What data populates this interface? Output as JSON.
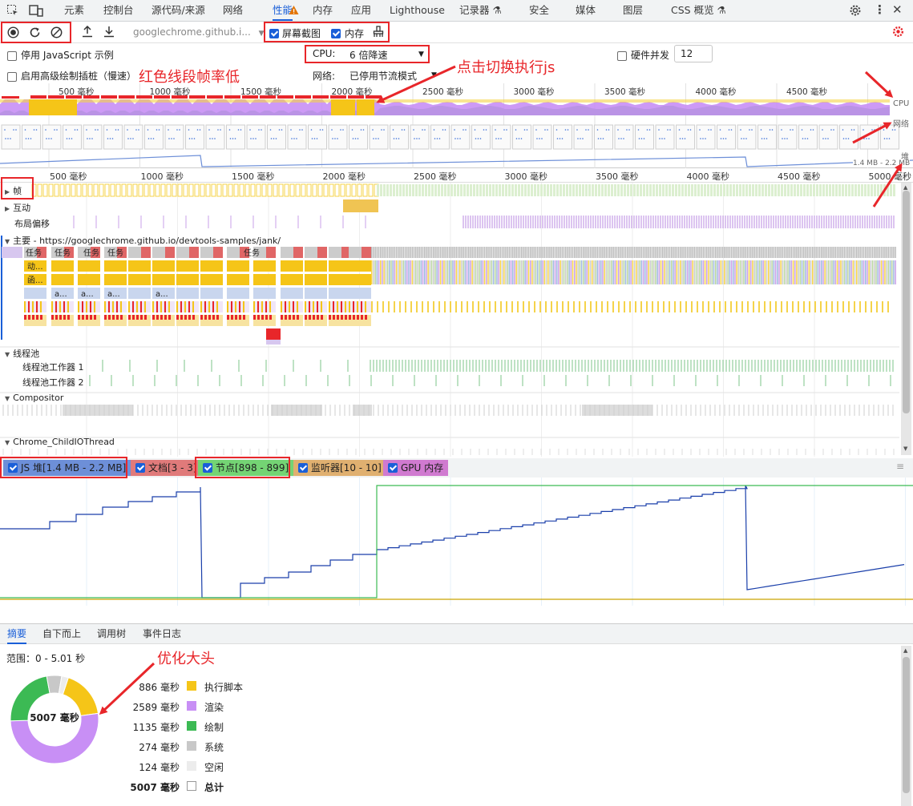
{
  "tabs": [
    {
      "label": "元素",
      "active": false
    },
    {
      "label": "控制台",
      "active": false
    },
    {
      "label": "源代码/来源",
      "active": false
    },
    {
      "label": "网络",
      "active": false
    },
    {
      "label": "性能",
      "active": true
    },
    {
      "label": "内存",
      "active": false
    },
    {
      "label": "应用",
      "active": false
    },
    {
      "label": "Lighthouse",
      "active": false
    },
    {
      "label": "记录器",
      "active": false
    },
    {
      "label": "安全",
      "active": false
    },
    {
      "label": "媒体",
      "active": false
    },
    {
      "label": "图层",
      "active": false
    },
    {
      "label": "CSS 概览",
      "active": false
    }
  ],
  "toolbar": {
    "url_select": "googlechrome.github.i...",
    "screenshots_label": "屏幕截图",
    "memory_label": "内存"
  },
  "settings": {
    "disable_js_samples": "停用 JavaScript 示例",
    "advanced_paint": "启用高级绘制插桩（慢速）",
    "cpu_label": "CPU:",
    "cpu_value": "6 倍降速",
    "network_label": "网络:",
    "network_value": "已停用节流模式",
    "hw_concurrency_label": "硬件并发",
    "hw_concurrency_value": "12"
  },
  "overview": {
    "ticks": [
      "500 毫秒",
      "1000 毫秒",
      "1500 毫秒",
      "2000 毫秒",
      "2500 毫秒",
      "3000 毫秒",
      "3500 毫秒",
      "4000 毫秒",
      "4500 毫秒"
    ],
    "cpu_label": "CPU",
    "net_label": "网络",
    "heap_label": "堆",
    "heap_range": "1.4 MB - 2.2 MB"
  },
  "timeline": {
    "ticks": [
      "500 毫秒",
      "1000 毫秒",
      "1500 毫秒",
      "2000 毫秒",
      "2500 毫秒",
      "3000 毫秒",
      "3500 毫秒",
      "4000 毫秒",
      "4500 毫秒",
      "5000 毫秒"
    ],
    "frames_label": "帧",
    "interactions_label": "互动",
    "layout_shifts_label": "布局偏移",
    "main_label": "主要 - https://googlechrome.github.io/devtools-samples/jank/",
    "task_label": "任务",
    "anim_label": "动...",
    "func_label": "函...",
    "a_label": "a...",
    "threadpool_label": "线程池",
    "worker1_label": "线程池工作器 1",
    "worker2_label": "线程池工作器 2",
    "compositor_label": "Compositor",
    "io_label": "Chrome_ChildIOThread"
  },
  "counters": [
    {
      "label": "JS 堆[1.4 MB - 2.2 MB]",
      "color": "#6d8fd8"
    },
    {
      "label": "文档[3 - 3]",
      "color": "#e07a7a"
    },
    {
      "label": "节点[898 - 899]",
      "color": "#74d474"
    },
    {
      "label": "监听器[10 - 10]",
      "color": "#e0b070"
    },
    {
      "label": "GPU 内存",
      "color": "#d07ad0"
    }
  ],
  "bottom_tabs": [
    "摘要",
    "自下而上",
    "调用树",
    "事件日志"
  ],
  "summary": {
    "range": "范围：0 - 5.01 秒",
    "total_center": "5007 毫秒",
    "rows": [
      {
        "value": "886 毫秒",
        "label": "执行脚本",
        "color": "#f5c518",
        "ms": 886
      },
      {
        "value": "2589 毫秒",
        "label": "渲染",
        "color": "#c88ff5",
        "ms": 2589
      },
      {
        "value": "1135 毫秒",
        "label": "绘制",
        "color": "#3cba54",
        "ms": 1135
      },
      {
        "value": "274 毫秒",
        "label": "系统",
        "color": "#c8c8c8",
        "ms": 274
      },
      {
        "value": "124 毫秒",
        "label": "空闲",
        "color": "#ececec",
        "ms": 124
      },
      {
        "value": "5007 毫秒",
        "label": "总计",
        "color": "#ffffff",
        "ms": 0
      }
    ]
  },
  "annotations": {
    "red_frames": "红色线段帧率低",
    "click_toggle": "点击切换执行js",
    "optimize": "优化大头"
  }
}
